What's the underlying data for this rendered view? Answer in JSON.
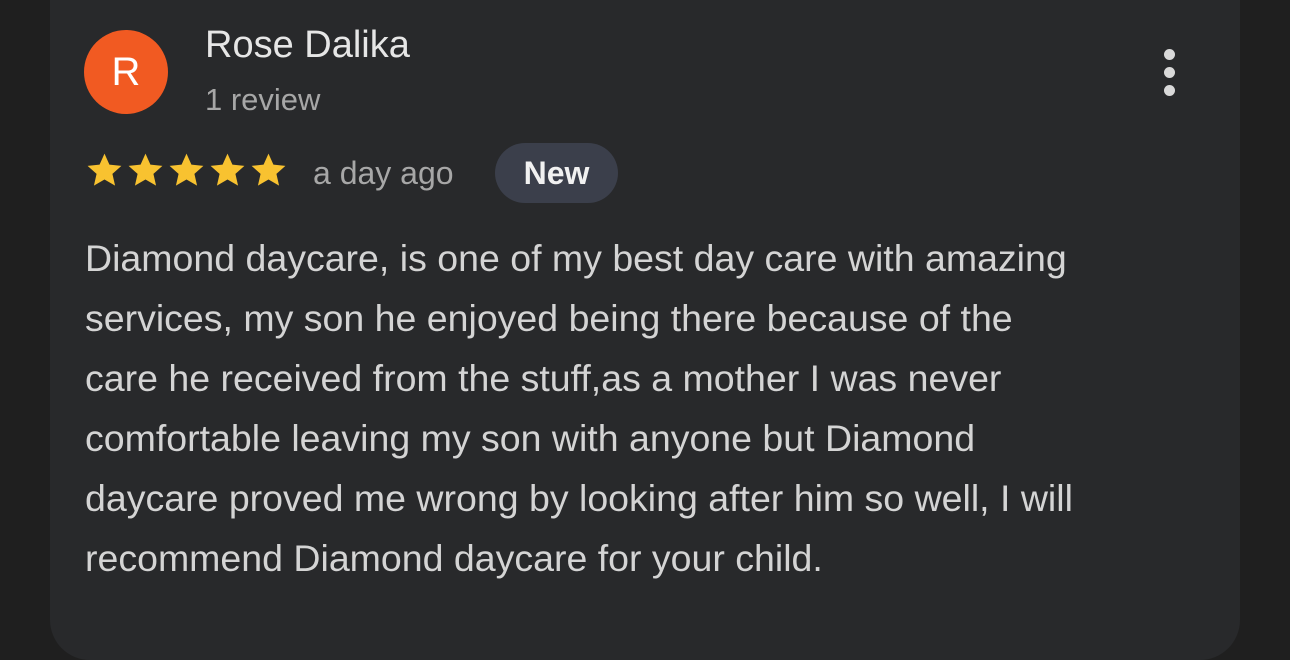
{
  "reviewer": {
    "initial": "R",
    "avatar_color": "#f15a22",
    "name": "Rose Dalika",
    "review_count": "1 review"
  },
  "menu": {
    "icon": "more-vert-icon"
  },
  "rating": {
    "stars": 5,
    "max": 5,
    "star_color": "#f8c230",
    "icon": "star-icon"
  },
  "time_ago": "a day ago",
  "badge": "New",
  "review": {
    "lines": [
      "Diamond daycare, is one of my best day care with amazing",
      "services, my son he enjoyed being there because of the",
      "care he received from the stuff,as a mother I was never",
      "comfortable leaving my son with anyone but Diamond",
      "daycare proved me wrong by looking after him so well, I will",
      "recommend Diamond daycare for your child."
    ]
  }
}
